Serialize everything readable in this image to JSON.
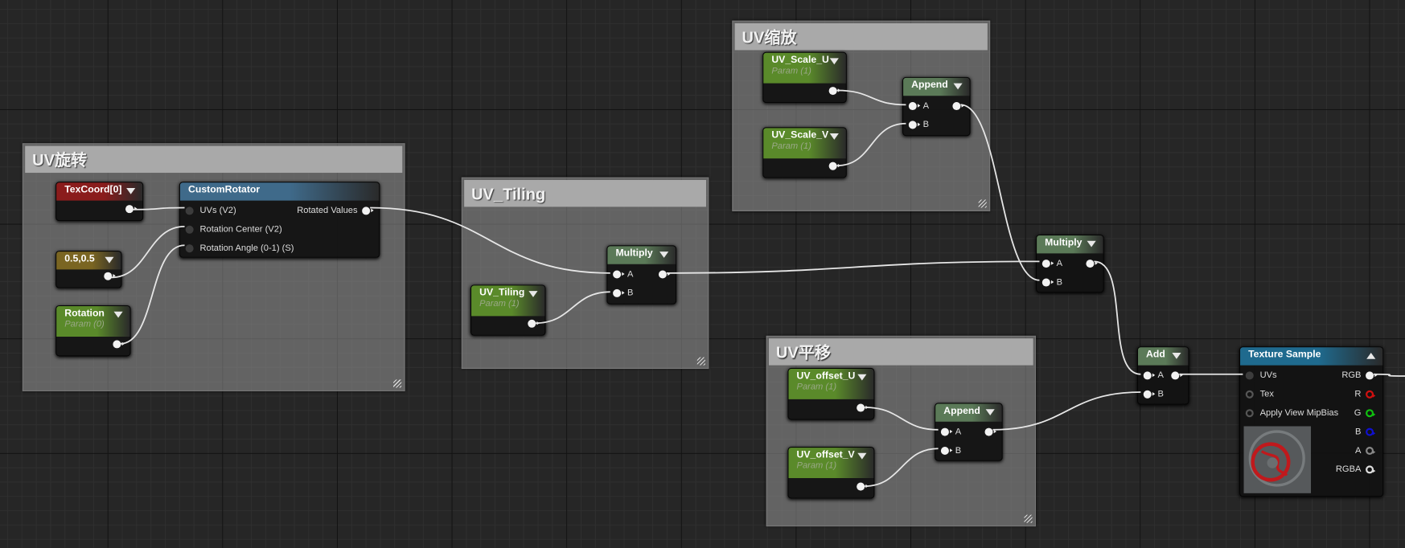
{
  "comments": [
    {
      "id": "c_rot",
      "title": "UV旋转"
    },
    {
      "id": "c_tiling",
      "title": "UV_Tiling"
    },
    {
      "id": "c_scale",
      "title": "UV缩放"
    },
    {
      "id": "c_offset",
      "title": "UV平移"
    }
  ],
  "nodes": [
    {
      "id": "texcoord",
      "title": "TexCoord[0]",
      "header_color": "#8a1c1c",
      "dropdown": true
    },
    {
      "id": "center",
      "title": "0.5,0.5",
      "header_color": "#7a6522",
      "dropdown": true
    },
    {
      "id": "rotation",
      "title": "Rotation",
      "subtitle": "Param (0)",
      "header_color": "#5a8a2a",
      "dropdown": true
    },
    {
      "id": "customrotator",
      "title": "CustomRotator",
      "header_color": "#3f6a8a",
      "inputs": [
        "UVs (V2)",
        "Rotation Center (V2)",
        "Rotation Angle (0-1) (S)"
      ],
      "outputs": [
        "Rotated Values"
      ]
    },
    {
      "id": "uvtiling",
      "title": "UV_Tiling",
      "subtitle": "Param (1)",
      "header_color": "#5a8a2a",
      "dropdown": true
    },
    {
      "id": "multiply1",
      "title": "Multiply",
      "header_color": "#5b7a58",
      "dropdown": true,
      "inputs": [
        "A",
        "B"
      ]
    },
    {
      "id": "scaleu",
      "title": "UV_Scale_U",
      "subtitle": "Param (1)",
      "header_color": "#5a8a2a",
      "dropdown": true
    },
    {
      "id": "scalev",
      "title": "UV_Scale_V",
      "subtitle": "Param (1)",
      "header_color": "#5a8a2a",
      "dropdown": true
    },
    {
      "id": "append1",
      "title": "Append",
      "header_color": "#5b7a58",
      "dropdown": true,
      "inputs": [
        "A",
        "B"
      ]
    },
    {
      "id": "multiply2",
      "title": "Multiply",
      "header_color": "#5b7a58",
      "dropdown": true,
      "inputs": [
        "A",
        "B"
      ]
    },
    {
      "id": "offsetu",
      "title": "UV_offset_U",
      "subtitle": "Param (1)",
      "header_color": "#5a8a2a",
      "dropdown": true
    },
    {
      "id": "offsetv",
      "title": "UV_offset_V",
      "subtitle": "Param (1)",
      "header_color": "#5a8a2a",
      "dropdown": true
    },
    {
      "id": "append2",
      "title": "Append",
      "header_color": "#5b7a58",
      "dropdown": true,
      "inputs": [
        "A",
        "B"
      ]
    },
    {
      "id": "add",
      "title": "Add",
      "header_color": "#5b7a58",
      "dropdown": true,
      "inputs": [
        "A",
        "B"
      ]
    },
    {
      "id": "texsample",
      "title": "Texture Sample",
      "header_color": "#1f6a8e",
      "collapse": true,
      "inputs": [
        "UVs",
        "Tex",
        "Apply View MipBias"
      ],
      "outputs": [
        "RGB",
        "R",
        "G",
        "B",
        "A",
        "RGBA"
      ],
      "output_colors": [
        "#f2f2f2",
        "#d01010",
        "#10c010",
        "#1010d0",
        "#888888",
        "#dddddd"
      ]
    }
  ],
  "wire_color": "#e6e6e6"
}
